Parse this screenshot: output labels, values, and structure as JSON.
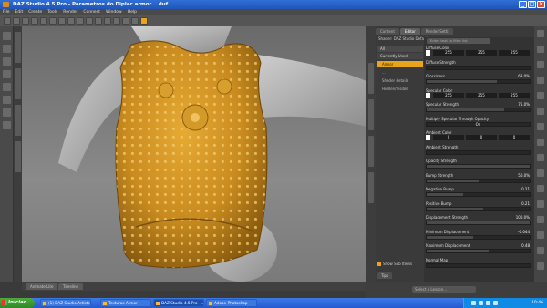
{
  "window": {
    "title": "DAZ Studio 4.5 Pro - Parametros do Diplac armor....duf"
  },
  "menu": [
    "File",
    "Edit",
    "Create",
    "Tools",
    "Render",
    "Connect",
    "Window",
    "Help"
  ],
  "panel": {
    "tabs": [
      "Content",
      "Editor",
      "Render Setti"
    ],
    "active_tab": "Editor",
    "shader_label": "Shader: DAZ Studio Default",
    "categories": [
      "All",
      "Currently Used"
    ],
    "tree": [
      {
        "label": "Armor",
        "selected": true
      },
      {
        "label": "...",
        "selected": false
      },
      {
        "label": "Shader details",
        "selected": false
      },
      {
        "label": "Hidden/Visible",
        "selected": false
      }
    ],
    "filter_placeholder": "Enter text to filter list",
    "properties": [
      {
        "label": "Diffuse Color",
        "kind": "color",
        "values": [
          "255",
          "255",
          "255"
        ]
      },
      {
        "label": "Diffuse Strength",
        "kind": "slider",
        "value": "",
        "fill": 0
      },
      {
        "label": "Glossiness",
        "kind": "slider",
        "value": "68.0%",
        "fill": 0.68
      },
      {
        "label": "Specular Color",
        "kind": "color",
        "values": [
          "255",
          "255",
          "255"
        ]
      },
      {
        "label": "Specular Strength",
        "kind": "slider",
        "value": "75.0%",
        "fill": 0.75
      },
      {
        "label": "Multiply Specular Through Opacity",
        "kind": "toggle",
        "value": "On"
      },
      {
        "label": "Ambient Color",
        "kind": "color",
        "values": [
          "0",
          "0",
          "0"
        ]
      },
      {
        "label": "Ambient Strength",
        "kind": "slider",
        "value": "",
        "fill": 0
      },
      {
        "label": "Opacity Strength",
        "kind": "slider",
        "value": "",
        "fill": 1
      },
      {
        "label": "Bump Strength",
        "kind": "slider",
        "value": "50.0%",
        "fill": 0.5
      },
      {
        "label": "Negative Bump",
        "kind": "slider",
        "value": "-0.21",
        "fill": 0.35
      },
      {
        "label": "Positive Bump",
        "kind": "slider",
        "value": "0.21",
        "fill": 0.55
      },
      {
        "label": "Displacement Strength",
        "kind": "slider",
        "value": "100.0%",
        "fill": 1
      },
      {
        "label": "Minimum Displacement",
        "kind": "slider",
        "value": "-0.044",
        "fill": 0.45
      },
      {
        "label": "Maximum Displacement",
        "kind": "slider",
        "value": "0.48",
        "fill": 0.6
      },
      {
        "label": "Normal Map",
        "kind": "slider",
        "value": "",
        "fill": 0
      }
    ],
    "show_sub_items": "Show Sub Items",
    "bottom_tab": "Tips"
  },
  "viewport_tabs": [
    "Animate Lite",
    "Timeline"
  ],
  "lesson_placeholder": "Select a Lesson...",
  "left_vertical_tabs": [
    "Scene",
    "Surface",
    "Tool Settings",
    "Parameters"
  ],
  "mid_vertical_tabs": [
    "Shaping",
    "Surfaces",
    "Lights",
    "Cameras"
  ],
  "taskbar": {
    "start": "Iniciar",
    "tasks": [
      "(1) DAZ Studio Artists",
      "Texturas Armor",
      "DAZ Studio 4.5 Pro - ...",
      "Adobe Photoshop"
    ],
    "clock": "10:46"
  },
  "colors": {
    "accent": "#e8a41a",
    "armor": "#c88a20",
    "skin": "#b5b5b5"
  }
}
